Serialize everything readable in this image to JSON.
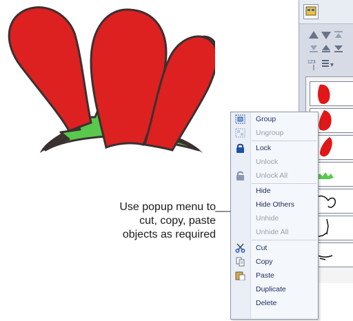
{
  "callout": {
    "lines": [
      "Use popup menu to",
      "cut, copy, paste",
      "objects as required"
    ]
  },
  "menu": {
    "items": [
      {
        "label": "Group",
        "icon": "group-icon",
        "enabled": true
      },
      {
        "label": "Ungroup",
        "icon": "ungroup-icon",
        "enabled": false
      },
      {
        "label": "Lock",
        "icon": "lock-icon",
        "enabled": true
      },
      {
        "label": "Unlock",
        "icon": "",
        "enabled": false
      },
      {
        "label": "Unlock All",
        "icon": "unlock-all-icon",
        "enabled": false
      },
      {
        "label": "Hide",
        "icon": "",
        "enabled": true
      },
      {
        "label": "Hide Others",
        "icon": "",
        "enabled": true
      },
      {
        "label": "Unhide",
        "icon": "",
        "enabled": false
      },
      {
        "label": "Unhide All",
        "icon": "",
        "enabled": false
      },
      {
        "label": "Cut",
        "icon": "scissors-icon",
        "enabled": true
      },
      {
        "label": "Copy",
        "icon": "copy-icon",
        "enabled": true
      },
      {
        "label": "Paste",
        "icon": "paste-icon",
        "enabled": true
      },
      {
        "label": "Duplicate",
        "icon": "",
        "enabled": true
      },
      {
        "label": "Delete",
        "icon": "",
        "enabled": true
      }
    ]
  },
  "panel": {
    "toolbar_icons": [
      "list-view-icon",
      "move-up-icon",
      "move-down-icon",
      "move-top-icon",
      "move-first-icon",
      "move-last-icon",
      "move-bottom-icon",
      "sequence-number-icon",
      "sort-icon"
    ],
    "thumbnails": [
      "red-petal-left",
      "red-petal-middle",
      "red-petal-right",
      "green-leaves",
      "outline-1",
      "outline-2",
      "outline-3"
    ]
  },
  "colors": {
    "petal_red": "#dd2020",
    "leaf_green": "#55c84a",
    "outline": "#3a3030",
    "menu_text": "#1c2a5c",
    "disabled_text": "#9aa0aa"
  }
}
